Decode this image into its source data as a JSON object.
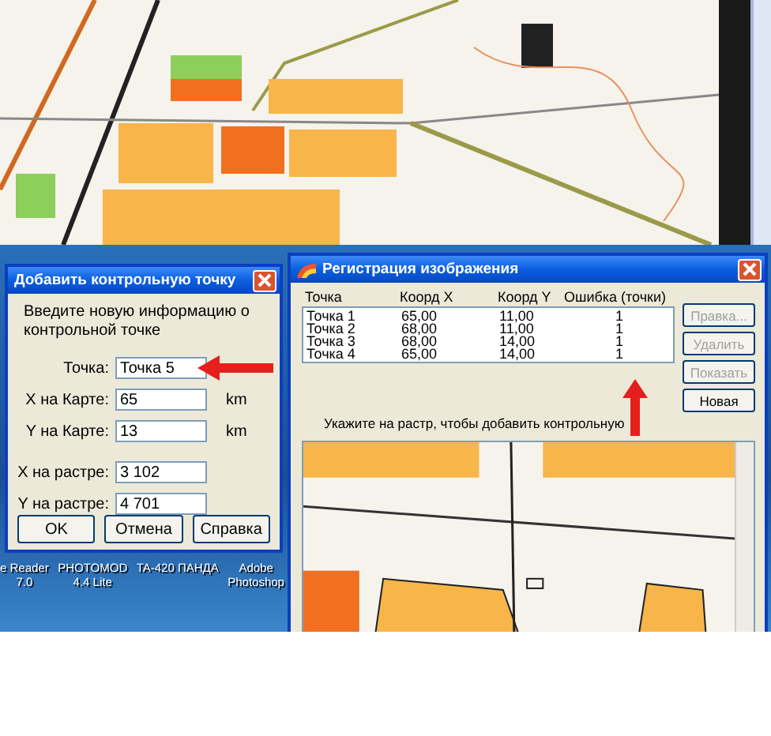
{
  "desktop_icons": [
    {
      "lines": [
        "e Reader",
        "7.0"
      ]
    },
    {
      "lines": [
        "PHOTOMOD",
        "4.4 Lite"
      ]
    },
    {
      "lines": [
        "TA-420 ПАНДА"
      ]
    },
    {
      "lines": [
        "Adobe",
        "Photoshop"
      ]
    }
  ],
  "add_point_dialog": {
    "title": "Добавить контрольную точку",
    "prompt": "Введите новую информацию о контрольной точке",
    "fields": [
      {
        "label": "Точка:",
        "value": "Точка 5"
      },
      {
        "label": "X на Карте:",
        "value": "65",
        "unit": "km"
      },
      {
        "label": "Y на Карте:",
        "value": "13",
        "unit": "km"
      },
      {
        "label": "X на растре:",
        "value": "3 102"
      },
      {
        "label": "Y на растре:",
        "value": "4 701"
      }
    ],
    "buttons": [
      "OK",
      "Отмена",
      "Справка"
    ]
  },
  "registration_window": {
    "title": "Регистрация изображения",
    "columns": [
      "Точка",
      "Коорд X",
      "Коорд Y",
      "Ошибка (точки)"
    ],
    "rows": [
      [
        "Точка 1",
        "65,00",
        "11,00",
        "1"
      ],
      [
        "Точка 2",
        "68,00",
        "11,00",
        "1"
      ],
      [
        "Точка 3",
        "68,00",
        "14,00",
        "1"
      ],
      [
        "Точка 4",
        "65,00",
        "14,00",
        "1"
      ]
    ],
    "buttons": [
      {
        "label": "Правка...",
        "disabled": true
      },
      {
        "label": "Удалить",
        "disabled": true
      },
      {
        "label": "Показать",
        "disabled": true
      },
      {
        "label": "Новая",
        "disabled": false
      }
    ],
    "hint": "Укажите на растр, чтобы добавить контрольную"
  }
}
